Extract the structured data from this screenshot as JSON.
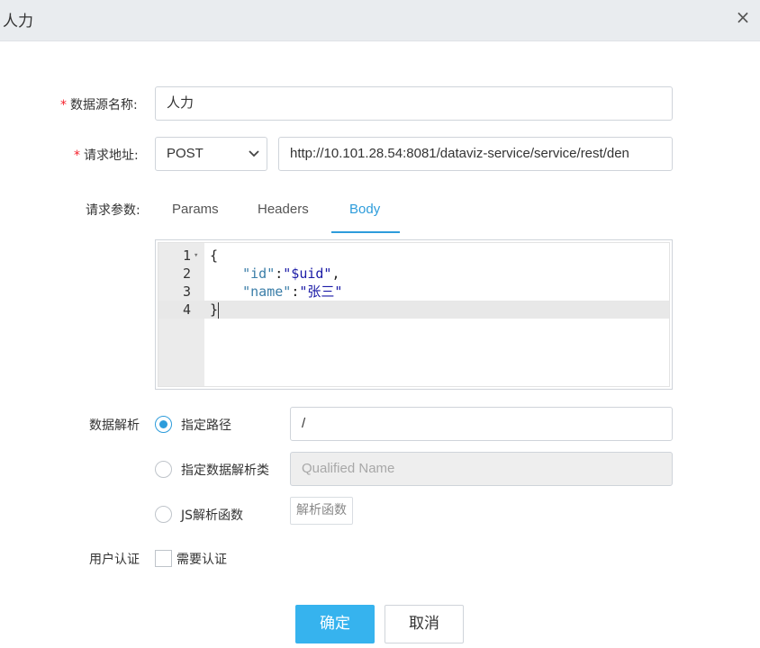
{
  "dialog": {
    "title": "人力",
    "close_label": "×"
  },
  "form": {
    "required_mark": "*",
    "name": {
      "label": "数据源名称:",
      "value": "人力"
    },
    "request": {
      "label": "请求地址:",
      "method": "POST",
      "url": "http://10.101.28.54:8081/dataviz-service/service/rest/den"
    },
    "params": {
      "label": "请求参数:",
      "tabs": [
        {
          "label": "Params",
          "active": false
        },
        {
          "label": "Headers",
          "active": false
        },
        {
          "label": "Body",
          "active": true
        }
      ]
    },
    "editor": {
      "lines": [
        {
          "number": "1",
          "text": "{"
        },
        {
          "number": "2",
          "key": "\"id\"",
          "sep": ":",
          "value": "\"$uid\"",
          "tail": ","
        },
        {
          "number": "3",
          "key": "\"name\"",
          "sep": ":",
          "value": "\"张三\"",
          "tail": ""
        },
        {
          "number": "4",
          "text": "}"
        }
      ]
    },
    "parse": {
      "label": "数据解析",
      "options": [
        {
          "label": "指定路径",
          "selected": true
        },
        {
          "label": "指定数据解析类",
          "selected": false
        },
        {
          "label": "JS解析函数",
          "selected": false
        }
      ],
      "path_value": "/",
      "class_placeholder": "Qualified Name",
      "function_button": "解析函数"
    },
    "auth": {
      "label": "用户认证",
      "checkbox_label": "需要认证",
      "checked": false
    }
  },
  "footer": {
    "confirm": "确定",
    "cancel": "取消"
  },
  "colors": {
    "accent": "#2d9cdb",
    "primary_button": "#36b3ee",
    "required": "#f5222d"
  }
}
